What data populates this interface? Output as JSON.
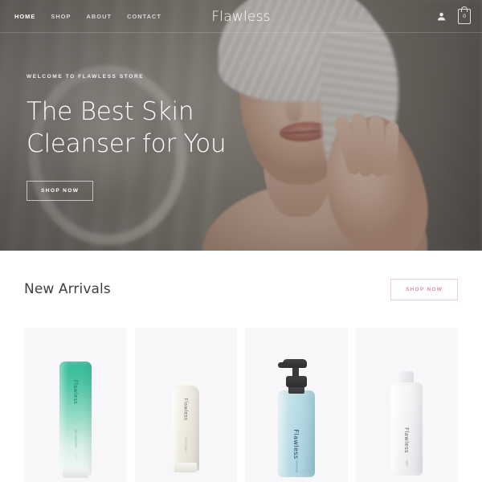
{
  "nav": {
    "links": [
      {
        "label": "HOME",
        "active": true
      },
      {
        "label": "SHOP",
        "active": false
      },
      {
        "label": "ABOUT",
        "active": false
      },
      {
        "label": "CONTACT",
        "active": false
      }
    ],
    "brand": "Flawless",
    "account_icon": "user-icon",
    "cart_icon": "shopping-bag-icon",
    "cart_count": "0"
  },
  "hero": {
    "eyebrow": "WELCOME TO FLAWLESS STORE",
    "title_line1": "The Best Skin",
    "title_line2": "Cleanser for You",
    "cta_label": "SHOP NOW"
  },
  "arrivals": {
    "title": "New Arrivals",
    "cta_label": "SHOP NOW",
    "cta_border_color": "#f0cdd6",
    "cta_text_color": "#e08ba0",
    "card_background": "#f7f7fa",
    "products": [
      {
        "name": "green-cleanser-tube",
        "brand_label": "Flawless",
        "sub_label": "SKIN CLEANSER",
        "sub_label2": "120 ml",
        "color": "#2fba95"
      },
      {
        "name": "cream-tube",
        "brand_label": "Flawless",
        "sub_label": "FACE CREAM",
        "color": "#efece3"
      },
      {
        "name": "blue-pump-bottle",
        "brand_label": "Flawless",
        "sub_label": "HAND WASH",
        "color": "#bcdde7"
      },
      {
        "name": "white-bottle",
        "brand_label": "Flawless",
        "sub_label": "TONER",
        "color": "#f6f6f7"
      }
    ]
  }
}
